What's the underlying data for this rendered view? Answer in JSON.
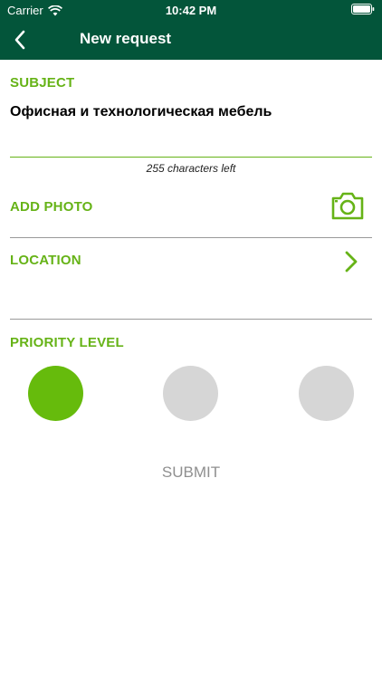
{
  "status_bar": {
    "carrier": "Carrier",
    "time": "10:42 PM",
    "wifi_icon": "wifi-icon",
    "battery_icon": "battery-icon"
  },
  "nav": {
    "title": "New request",
    "back_icon": "chevron-left-icon"
  },
  "form": {
    "subject_label": "SUBJECT",
    "subject_value": "Офисная и технологическая мебель",
    "chars_left": "255 characters left",
    "add_photo_label": "ADD PHOTO",
    "camera_icon": "camera-icon",
    "location_label": "LOCATION",
    "location_icon": "chevron-right-icon",
    "priority_label": "PRIORITY LEVEL",
    "priority_options": [
      {
        "selected": true,
        "color": "#66bb0c"
      },
      {
        "selected": false,
        "color": "#d6d6d6"
      },
      {
        "selected": false,
        "color": "#d6d6d6"
      }
    ],
    "submit_label": "SUBMIT"
  },
  "colors": {
    "header_bg": "#03553a",
    "accent": "#66b317",
    "inactive": "#d6d6d6"
  }
}
